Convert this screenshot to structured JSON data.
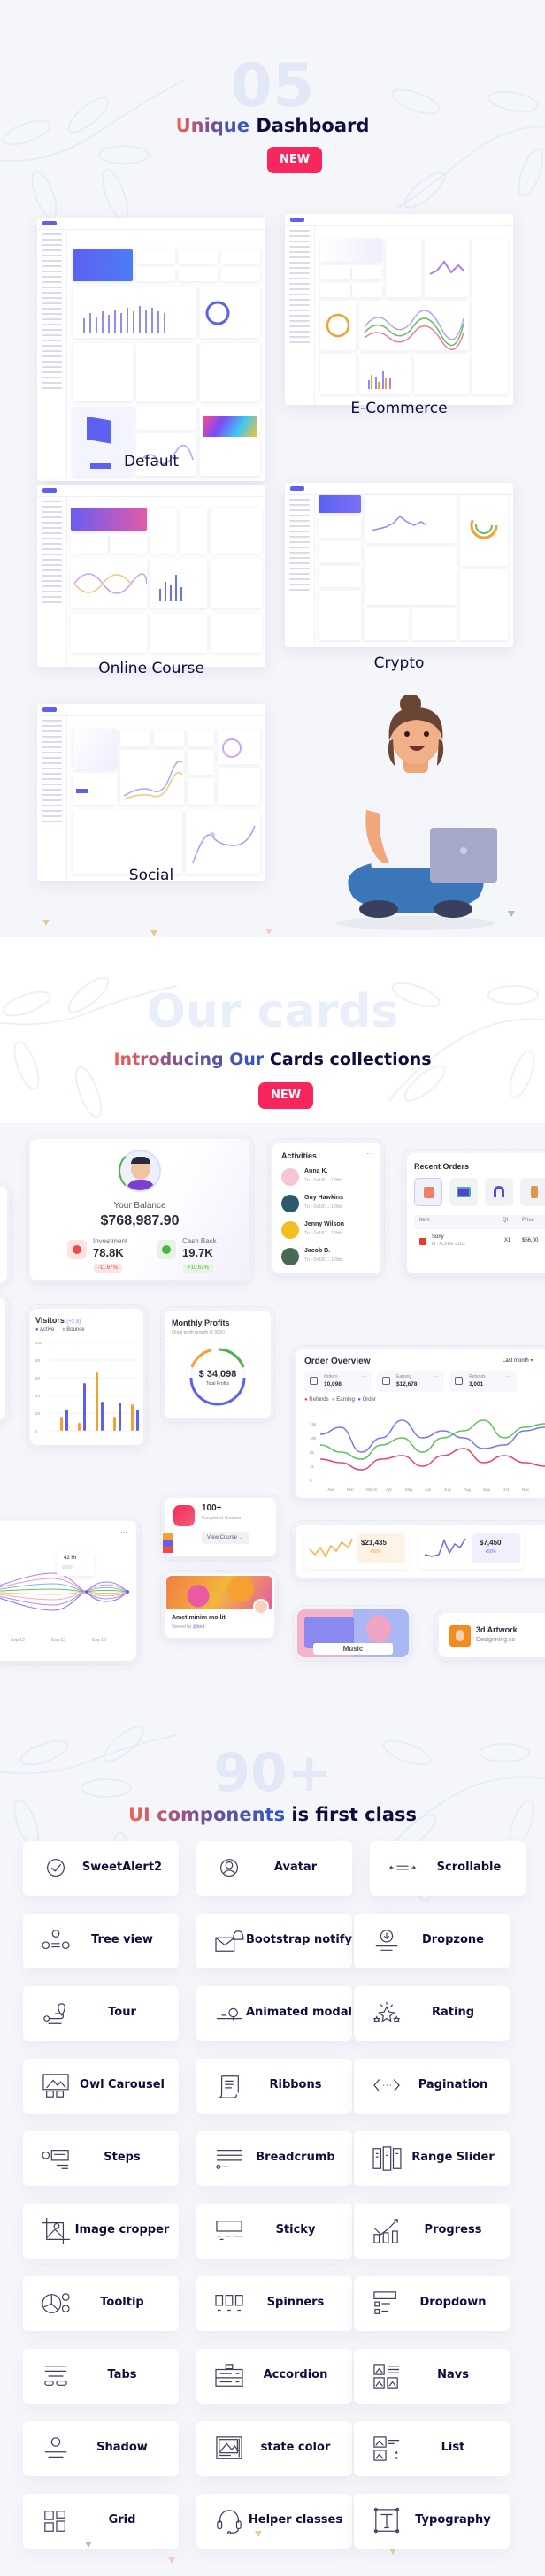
{
  "section1": {
    "big_number": "05",
    "heading_accent": "Unique",
    "heading_rest": "Dashboard",
    "badge": "NEW",
    "dashboards": [
      {
        "label": "Default"
      },
      {
        "label": "E-Commerce"
      },
      {
        "label": "Online Course"
      },
      {
        "label": "Crypto"
      },
      {
        "label": "Social"
      }
    ]
  },
  "section2": {
    "big_text": "Our cards",
    "heading_accent": "Introducing Our",
    "heading_rest": "Cards collections",
    "badge": "NEW",
    "balance_card": {
      "label": "Your Balance",
      "amount": "$768,987.90",
      "investment_label": "Investment",
      "investment_value": "78.8K",
      "investment_change": "-11.67%",
      "cashback_label": "Cash Back",
      "cashback_value": "19.7K",
      "cashback_change": "+10.67%"
    },
    "activities": {
      "title": "Activities",
      "more": "···",
      "items": [
        {
          "name": "Anna K.",
          "sub": "To : 0x187...12bb",
          "color": "#f6c6d6"
        },
        {
          "name": "Guy Hawkins",
          "sub": "To : 0x187...12bb",
          "color": "#2d5a6a"
        },
        {
          "name": "Jenny Wilson",
          "sub": "To : 0x187...12bb",
          "color": "#f5bd1e"
        },
        {
          "name": "Jacob B.",
          "sub": "To : 0x187...12bb",
          "color": "#466a55"
        }
      ]
    },
    "recent_orders": {
      "title": "Recent Orders",
      "columns": [
        "Item",
        "Qt",
        "Price"
      ],
      "rows": [
        {
          "name": "Sony",
          "id": "Id : #CFDE-2163",
          "qty": "X1",
          "price": "$56.00"
        }
      ]
    },
    "visitors": {
      "title": "Visitors",
      "change": "(+2.8)",
      "legend": [
        "Active",
        "Bounce"
      ]
    },
    "monthly_profits": {
      "title": "Monthly Profits",
      "subtitle": "(Total profit growth of 30%)",
      "amount": "$ 34,098",
      "amount_label": "Total Profits"
    },
    "order_overview": {
      "title": "Order Overview",
      "period": "Last month",
      "stats": [
        {
          "label": "Orders",
          "value": "10,098"
        },
        {
          "label": "Earning",
          "value": "$12,678"
        },
        {
          "label": "Refunds",
          "value": "3,001"
        }
      ],
      "legend": [
        "Refunds",
        "Earning",
        "Order"
      ]
    },
    "courses_card": {
      "value": "100+",
      "label": "Completed Courses",
      "button": "View Course"
    },
    "hours_card": {
      "tooltip_value": "42 Hr",
      "more": "···"
    },
    "nft_card": {
      "title": "Amet minim mollit",
      "owner_prefix": "Owned by",
      "owner": "@tout"
    },
    "spark_cards": [
      {
        "value": "$21,435",
        "change": "+50%"
      },
      {
        "value": "$7,450",
        "change": "+50%"
      }
    ],
    "music_card": {
      "label": "Music"
    },
    "artwork_card": {
      "title": "3d Artwork",
      "subtitle": "Designning.co"
    }
  },
  "section3": {
    "big_text": "90+",
    "heading_accent": "UI components",
    "heading_rest": "is first class",
    "components": [
      {
        "label": "SweetAlert2",
        "icon": "check-circle-icon"
      },
      {
        "label": "Avatar",
        "icon": "user-circle-icon"
      },
      {
        "label": "Scrollable",
        "icon": "horizontal-scroll-icon"
      },
      {
        "label": "Tree view",
        "icon": "tree-view-icon"
      },
      {
        "label": "Bootstrap notify",
        "icon": "envelope-bell-icon"
      },
      {
        "label": "Dropzone",
        "icon": "download-circle-icon"
      },
      {
        "label": "Tour",
        "icon": "map-route-icon"
      },
      {
        "label": "Animated modal",
        "icon": "animated-modal-icon"
      },
      {
        "label": "Rating",
        "icon": "stars-icon"
      },
      {
        "label": "Owl Carousel",
        "icon": "image-gallery-icon"
      },
      {
        "label": "Ribbons",
        "icon": "scroll-document-icon"
      },
      {
        "label": "Pagination",
        "icon": "code-brackets-icon"
      },
      {
        "label": "Steps",
        "icon": "steps-icon"
      },
      {
        "label": "Breadcrumb",
        "icon": "breadcrumb-lines-icon"
      },
      {
        "label": "Range Slider",
        "icon": "range-slider-icon"
      },
      {
        "label": "Image cropper",
        "icon": "crop-image-icon"
      },
      {
        "label": "Sticky",
        "icon": "sticky-note-icon"
      },
      {
        "label": "Progress",
        "icon": "bar-chart-trend-icon"
      },
      {
        "label": "Tooltip",
        "icon": "pie-tooltip-icon"
      },
      {
        "label": "Spinners",
        "icon": "digital-clock-icon"
      },
      {
        "label": "Dropdown",
        "icon": "dropdown-list-icon"
      },
      {
        "label": "Tabs",
        "icon": "tabs-icon"
      },
      {
        "label": "Accordion",
        "icon": "accordion-icon"
      },
      {
        "label": "Navs",
        "icon": "nav-images-icon"
      },
      {
        "label": "Shadow",
        "icon": "shadow-icon"
      },
      {
        "label": "state color",
        "icon": "image-window-icon"
      },
      {
        "label": "List",
        "icon": "image-list-icon"
      },
      {
        "label": "Grid",
        "icon": "grid-icon"
      },
      {
        "label": "Helper classes",
        "icon": "headset-icon"
      },
      {
        "label": "Typography",
        "icon": "typography-icon"
      }
    ]
  },
  "colors": {
    "primary": "#5c61f2",
    "accent_red": "#f7275e",
    "warning": "#f6a031",
    "success": "#4bb543",
    "heading": "#0d0e3d"
  }
}
